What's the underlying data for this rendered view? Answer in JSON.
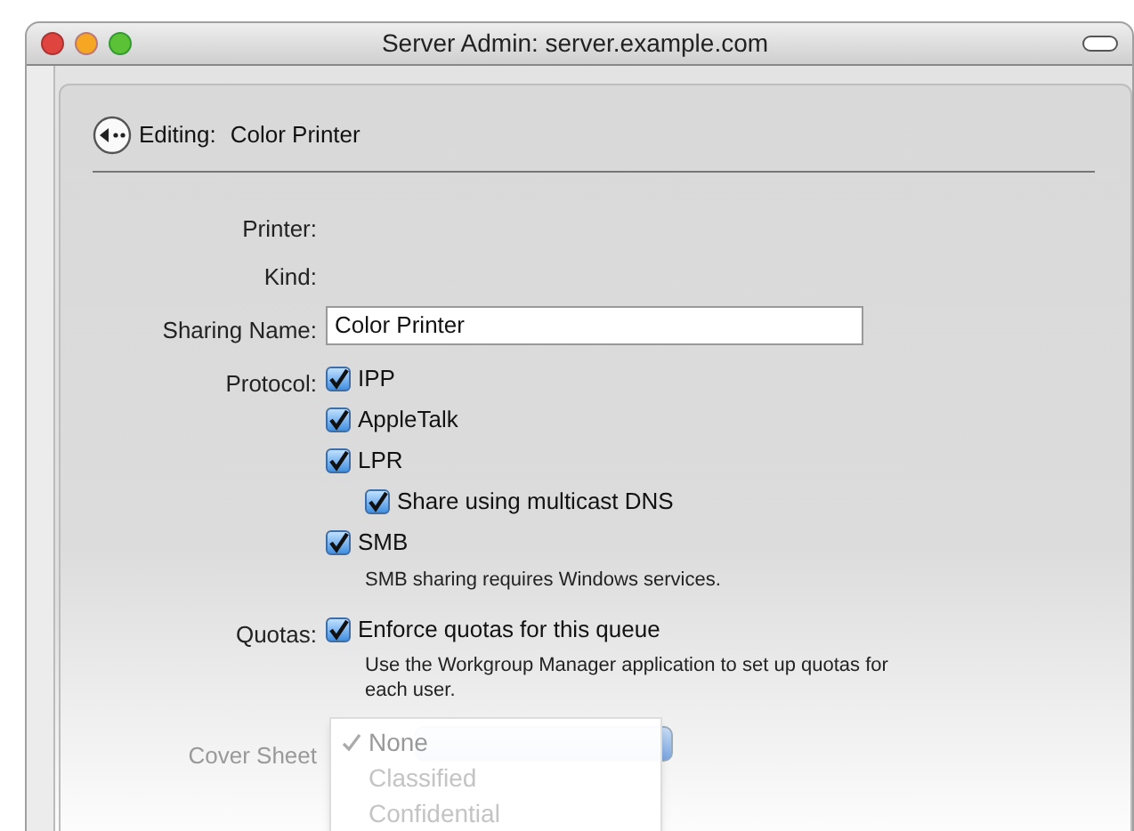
{
  "window": {
    "title": "Server Admin: server.example.com"
  },
  "header": {
    "label": "Editing:",
    "value": "Color Printer"
  },
  "printer": {
    "label": "Printer:"
  },
  "kind": {
    "label": "Kind:"
  },
  "sharing_name": {
    "label": "Sharing Name:",
    "value": "Color Printer"
  },
  "protocol": {
    "label": "Protocol:",
    "options": [
      {
        "label": "IPP",
        "checked": true
      },
      {
        "label": "AppleTalk",
        "checked": true
      },
      {
        "label": "LPR",
        "checked": true,
        "children": [
          {
            "label": "Share using multicast DNS",
            "checked": true
          }
        ]
      },
      {
        "label": "SMB",
        "checked": true,
        "note": "SMB sharing requires Windows services."
      }
    ]
  },
  "quotas": {
    "label": "Quotas:",
    "option": {
      "label": "Enforce quotas for this queue",
      "checked": true
    },
    "note": "Use the Workgroup Manager application to set up quotas for each user."
  },
  "cover_sheet": {
    "label": "Cover Sheet",
    "menu": [
      {
        "label": "None",
        "selected": true
      },
      {
        "label": "Classified",
        "selected": false
      },
      {
        "label": "Confidential",
        "selected": false
      }
    ]
  }
}
